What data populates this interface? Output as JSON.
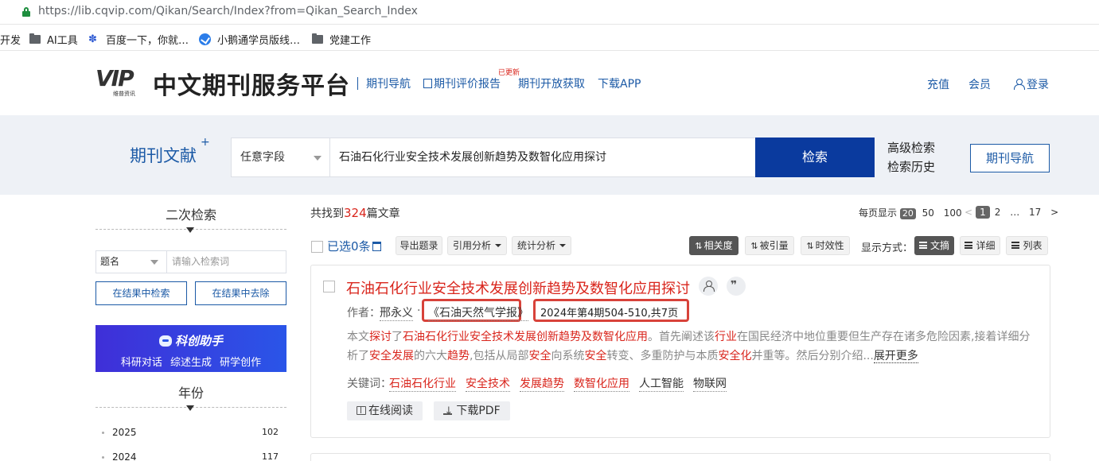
{
  "browser": {
    "url": "https://lib.cqvip.com/Qikan/Search/Index?from=Qikan_Search_Index",
    "bookmarks": [
      "开发",
      "AI工具",
      "百度一下，你就…",
      "小鹅通学员版线…",
      "党建工作"
    ]
  },
  "header": {
    "logo_text": "VIP",
    "logo_sub": "维普资讯",
    "site_title": "中文期刊服务平台",
    "nav": [
      "期刊导航",
      "期刊评价报告",
      "期刊开放获取",
      "下载APP"
    ],
    "new_badge": "已更新",
    "user_links": [
      "充值",
      "会员",
      "登录"
    ]
  },
  "search": {
    "label": "期刊文献",
    "label_plus": "+",
    "field": "任意字段",
    "query": "石油石化行业安全技术发展创新趋势及数智化应用探讨",
    "button": "检索",
    "advanced": "高级检索",
    "history": "检索历史",
    "journal_nav": "期刊导航"
  },
  "sidebar": {
    "secondary_title": "二次检索",
    "field": "题名",
    "input_placeholder": "请输入检索词",
    "btn_in_results": "在结果中检索",
    "btn_exclude": "在结果中去除",
    "banner_title": "科创助手",
    "banner_items": "科研对话  综述生成  研学创作",
    "year_title": "年份",
    "years": [
      {
        "year": "2025",
        "count": "102"
      },
      {
        "year": "2024",
        "count": "117"
      }
    ]
  },
  "results": {
    "found_prefix": "共找到",
    "found_count": "324",
    "found_suffix": "篇文章",
    "per_page_label": "每页显示",
    "per_page_options": [
      "20",
      "50",
      "100"
    ],
    "pages": [
      "<",
      "1",
      "2",
      "…",
      "17",
      ">"
    ],
    "selected_prefix": "已选",
    "selected_count": "0",
    "selected_suffix": "条",
    "toolbar": [
      "导出题录",
      "引用分析",
      "统计分析"
    ],
    "sort": [
      "相关度",
      "被引量",
      "时效性"
    ],
    "display_label": "显示方式：",
    "display_modes": [
      "文摘",
      "详细",
      "列表"
    ]
  },
  "item": {
    "title": "石油石化行业安全技术发展创新趋势及数智化应用探讨",
    "author_label": "作者：",
    "author": "邢永义",
    "journal": "《石油天然气学报》",
    "issue": "2024年第4期504-510,共7页",
    "abstract_parts": [
      {
        "t": "本文",
        "hl": false
      },
      {
        "t": "探讨",
        "hl": true
      },
      {
        "t": "了",
        "hl": false
      },
      {
        "t": "石油石化行业安全技术发展创新趋势及数智化应用",
        "hl": true
      },
      {
        "t": "。首先阐述该",
        "hl": false
      },
      {
        "t": "行业",
        "hl": true
      },
      {
        "t": "在国民经济中地位重要但生产存在诸多危险因素,接着详细分析了",
        "hl": false
      },
      {
        "t": "安全发展",
        "hl": true
      },
      {
        "t": "的六大",
        "hl": false
      },
      {
        "t": "趋势",
        "hl": true
      },
      {
        "t": ",包括从局部",
        "hl": false
      },
      {
        "t": "安全",
        "hl": true
      },
      {
        "t": "向系统",
        "hl": false
      },
      {
        "t": "安全",
        "hl": true
      },
      {
        "t": "转变、多重防护与本质",
        "hl": false
      },
      {
        "t": "安全化",
        "hl": true
      },
      {
        "t": "并重等。然后分别介绍...",
        "hl": false
      }
    ],
    "expand": "展开更多",
    "keywords_label": "关键词：",
    "keywords": [
      "石油石化行业",
      "安全技术",
      "发展趋势",
      "数智化应用",
      "人工智能",
      "物联网"
    ],
    "online_read": "在线阅读",
    "download_pdf": "下载PDF"
  },
  "colors": {
    "brand_blue": "#1c5aa6",
    "search_button": "#0a3a9e",
    "highlight_red": "#d9251c",
    "annotation_box": "#d8423a"
  }
}
